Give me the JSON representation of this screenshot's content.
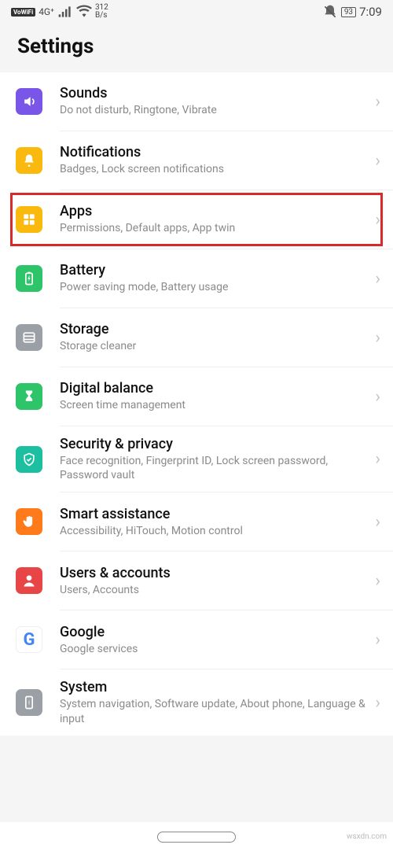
{
  "status": {
    "vowifi": "VoWiFi",
    "net_gen": "4G⁺",
    "speed_top": "312",
    "speed_bot": "B/s",
    "battery_pct": "93",
    "time": "7:09"
  },
  "header": {
    "title": "Settings"
  },
  "rows": [
    {
      "title": "Sounds",
      "subtitle": "Do not disturb, Ringtone, Vibrate",
      "icon_bg": "#7a56e8",
      "icon_name": "sound-icon"
    },
    {
      "title": "Notifications",
      "subtitle": "Badges, Lock screen notifications",
      "icon_bg": "#f9b90f",
      "icon_name": "bell-icon"
    },
    {
      "title": "Apps",
      "subtitle": "Permissions, Default apps, App twin",
      "icon_bg": "#f9b90f",
      "icon_name": "apps-icon",
      "highlighted": true
    },
    {
      "title": "Battery",
      "subtitle": "Power saving mode, Battery usage",
      "icon_bg": "#2ec46a",
      "icon_name": "battery-icon"
    },
    {
      "title": "Storage",
      "subtitle": "Storage cleaner",
      "icon_bg": "#9aa0a6",
      "icon_name": "storage-icon"
    },
    {
      "title": "Digital balance",
      "subtitle": "Screen time management",
      "icon_bg": "#2ec46a",
      "icon_name": "hourglass-icon"
    },
    {
      "title": "Security & privacy",
      "subtitle": "Face recognition, Fingerprint ID, Lock screen password, Password vault",
      "icon_bg": "#1cc0a0",
      "icon_name": "shield-icon"
    },
    {
      "title": "Smart assistance",
      "subtitle": "Accessibility, HiTouch, Motion control",
      "icon_bg": "#ff7a1a",
      "icon_name": "hand-icon"
    },
    {
      "title": "Users & accounts",
      "subtitle": "Users, Accounts",
      "icon_bg": "#e84646",
      "icon_name": "user-icon"
    },
    {
      "title": "Google",
      "subtitle": "Google services",
      "icon_bg": "#ffffff",
      "icon_name": "google-g-icon",
      "google": true
    },
    {
      "title": "System",
      "subtitle": "System navigation, Software update, About phone, Language & input",
      "icon_bg": "#9aa0a6",
      "icon_name": "system-icon"
    }
  ],
  "watermark": "wsxdn.com"
}
